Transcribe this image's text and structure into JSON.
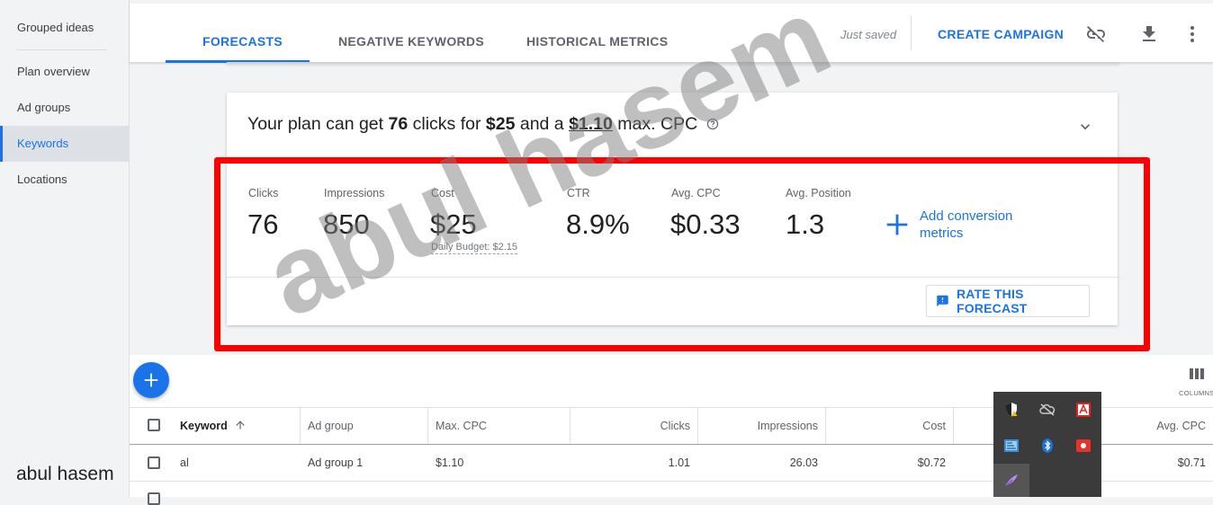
{
  "sidebar": {
    "items": [
      {
        "label": "Grouped ideas"
      },
      {
        "label": "Plan overview"
      },
      {
        "label": "Ad groups"
      },
      {
        "label": "Keywords"
      },
      {
        "label": "Locations"
      }
    ],
    "active": "Keywords",
    "bottom_text": "abul hasem"
  },
  "header": {
    "tabs": [
      {
        "label": "FORECASTS"
      },
      {
        "label": "NEGATIVE KEYWORDS"
      },
      {
        "label": "HISTORICAL METRICS"
      }
    ],
    "active_tab": "FORECASTS",
    "status": "Just saved",
    "create_label": "CREATE CAMPAIGN",
    "icons": [
      "link-off-icon",
      "download-icon",
      "more-vert-icon"
    ]
  },
  "forecast": {
    "summary": {
      "prefix": "Your plan can get ",
      "clicks": "76",
      "mid1": " clicks for ",
      "cost": "$25",
      "mid2": " and a ",
      "cpc": "$1.10",
      "suffix": " max. CPC"
    },
    "metrics": [
      {
        "label": "Clicks",
        "value": "76"
      },
      {
        "label": "Impressions",
        "value": "850"
      },
      {
        "label": "Cost",
        "value": "$25"
      },
      {
        "label": "CTR",
        "value": "8.9%"
      },
      {
        "label": "Avg. CPC",
        "value": "$0.33"
      },
      {
        "label": "Avg. Position",
        "value": "1.3"
      }
    ],
    "daily_budget": "Daily Budget: $2.15",
    "add_conversion": {
      "line1": "Add conversion",
      "line2": "metrics"
    },
    "rate_label": "RATE THIS FORECAST"
  },
  "watermark": "abul hasem",
  "table": {
    "columns_label": "COLUMNS",
    "headers": [
      "Keyword",
      "Ad group",
      "Max. CPC",
      "Clicks",
      "Impressions",
      "Cost",
      "Avg. CPC"
    ],
    "rows": [
      {
        "keyword": "al",
        "ad_group": "Ad group 1",
        "max_cpc": "$1.10",
        "clicks": "1.01",
        "impressions": "26.03",
        "cost": "$0.72",
        "avg_cpc": "$0.71"
      }
    ]
  },
  "colors": {
    "accent": "#1a73e8",
    "highlight": "#ff0000",
    "tray_bg": "#3b3b3b"
  }
}
